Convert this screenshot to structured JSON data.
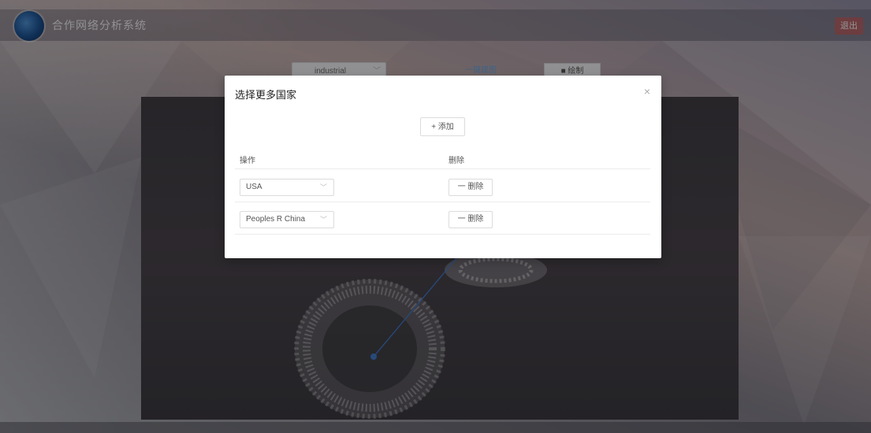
{
  "header": {
    "app_title": "合作网络分析系统",
    "logout_label": "退出"
  },
  "toolbar": {
    "field_select_value": "industrial biotechnology",
    "action_label": "一键建图",
    "draw_label": "绘制"
  },
  "modal": {
    "title": "选择更多国家",
    "close_icon": "close-icon",
    "add_label": "+ 添加",
    "columns": [
      "操作",
      "删除"
    ],
    "rows": [
      {
        "country": "USA",
        "delete_label": "一 删除"
      },
      {
        "country": "Peoples R China",
        "delete_label": "一 删除"
      }
    ]
  },
  "colors": {
    "overlay": "#000000",
    "modal_bg": "#ffffff",
    "graph_edge": "#3f78c8"
  }
}
